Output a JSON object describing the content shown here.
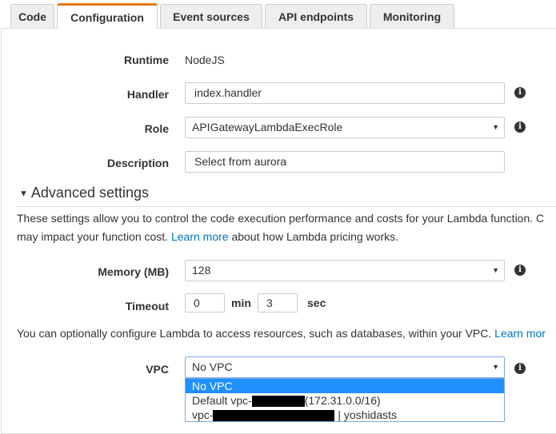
{
  "tabs": [
    "Code",
    "Configuration",
    "Event sources",
    "API endpoints",
    "Monitoring"
  ],
  "active_tab": "Configuration",
  "runtime": {
    "label": "Runtime",
    "value": "NodeJS"
  },
  "handler": {
    "label": "Handler",
    "value": "index.handler"
  },
  "role": {
    "label": "Role",
    "value": "APIGatewayLambdaExecRole"
  },
  "description": {
    "label": "Description",
    "value": "Select from aurora"
  },
  "advanced": {
    "title": "Advanced settings",
    "text1": "These settings allow you to control the code execution performance and costs for your Lambda function. C",
    "text2a": "may impact your function cost. ",
    "link": "Learn more",
    "text2b": " about how Lambda pricing works."
  },
  "memory": {
    "label": "Memory (MB)",
    "value": "128"
  },
  "timeout": {
    "label": "Timeout",
    "min": "0",
    "min_unit": "min",
    "sec": "3",
    "sec_unit": "sec"
  },
  "vpc_text": {
    "text": "You can optionally configure Lambda to access resources, such as databases, within your VPC. ",
    "link": "Learn mor"
  },
  "vpc": {
    "label": "VPC",
    "value": "No VPC",
    "options": [
      {
        "a": "No VPC",
        "b": ""
      },
      {
        "a": "Default vpc-",
        "b": "(172.31.0.0/16)"
      },
      {
        "a": "vpc-",
        "b": "| yoshidasts"
      }
    ]
  }
}
